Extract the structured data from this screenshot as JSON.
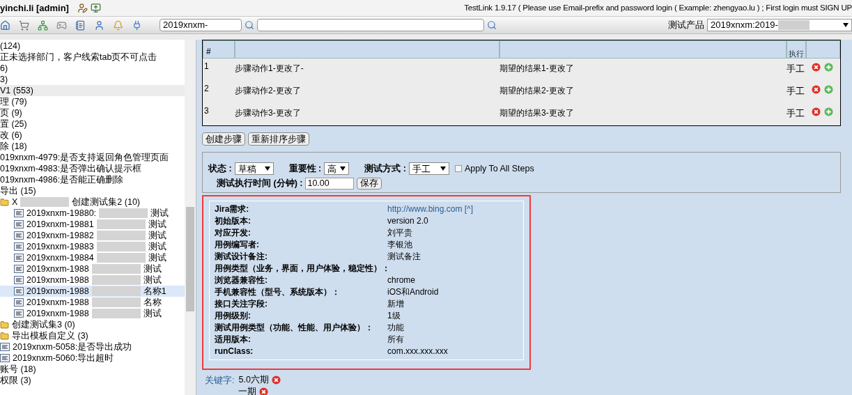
{
  "header": {
    "user": "yinchi.li [admin]",
    "title": "TestLink 1.9.17 ( Please use Email-prefix and password login ( Example: zhengyao.lu ) ; First login must SIGN UP"
  },
  "toolbar": {
    "search_value": "2019xnxm-",
    "product_label": "测试产品",
    "product_value": "2019xnxm:2019-"
  },
  "tree": [
    {
      "kind": "text",
      "label": "(124)",
      "selected": false
    },
    {
      "kind": "text",
      "label": "正未选择部门，客户线索tab页不可点击",
      "selected": false
    },
    {
      "kind": "text",
      "label": "6)",
      "selected": false
    },
    {
      "kind": "text",
      "label": "3)",
      "selected": false
    },
    {
      "kind": "text",
      "label": "V1 (553)",
      "selected": true
    },
    {
      "kind": "text",
      "label": "理 (79)",
      "selected": false
    },
    {
      "kind": "text",
      "label": "页 (9)",
      "selected": false
    },
    {
      "kind": "text",
      "label": "置 (25)",
      "selected": false
    },
    {
      "kind": "text",
      "label": "改 (6)",
      "selected": false
    },
    {
      "kind": "text",
      "label": "除 (18)",
      "selected": false
    },
    {
      "kind": "text",
      "label": "019xnxm-4979:是否支持返回角色管理页面",
      "selected": false
    },
    {
      "kind": "text",
      "label": "019xnxm-4983:是否弹出确认提示框",
      "selected": false
    },
    {
      "kind": "text",
      "label": "019xnxm-4986:是否能正确删除",
      "selected": false
    },
    {
      "kind": "text",
      "label": "导出 (15)",
      "selected": false
    },
    {
      "kind": "folder",
      "label": "X",
      "tail": "创建测试集2 (10)",
      "selected": false,
      "children": [
        {
          "kind": "case",
          "label": "2019xnxm-19880:",
          "tail": "测试",
          "selected": false
        },
        {
          "kind": "case",
          "label": "2019xnxm-19881",
          "tail": "测试",
          "selected": false
        },
        {
          "kind": "case",
          "label": "2019xnxm-19882",
          "tail": "测试",
          "selected": false
        },
        {
          "kind": "case",
          "label": "2019xnxm-19883",
          "tail": "测试",
          "selected": false
        },
        {
          "kind": "case",
          "label": "2019xnxm-19884",
          "tail": "测试",
          "selected": false
        },
        {
          "kind": "case",
          "label": "2019xnxm-1988",
          "tail": "测试",
          "selected": false
        },
        {
          "kind": "case",
          "label": "2019xnxm-1988",
          "tail": "测试",
          "selected": false
        },
        {
          "kind": "case",
          "label": "2019xnxm-1988",
          "tail": "名称1",
          "selected": true
        },
        {
          "kind": "case",
          "label": "2019xnxm-1988",
          "tail": "名称",
          "selected": false
        },
        {
          "kind": "case",
          "label": "2019xnxm-1988",
          "tail": "测试",
          "selected": false
        }
      ]
    },
    {
      "kind": "folder",
      "label": "创建测试集3 (0)",
      "selected": false
    },
    {
      "kind": "folder",
      "label": "导出模板自定义 (3)",
      "selected": false
    },
    {
      "kind": "case",
      "label": "2019xnxm-5058:是否导出成功",
      "selected": false
    },
    {
      "kind": "case",
      "label": "2019xnxm-5060:导出超时",
      "selected": false
    },
    {
      "kind": "text",
      "label": "账号 (18)",
      "selected": false
    },
    {
      "kind": "text",
      "label": "权限 (3)",
      "selected": false
    }
  ],
  "steps": {
    "columns": {
      "number": "#",
      "execution": "执行"
    },
    "rows": [
      {
        "number": "1",
        "action": "步骤动作1-更改了-",
        "expected": "期望的结果1-更改了",
        "execution": "手工"
      },
      {
        "number": "2",
        "action": "步骤动作2-更改了",
        "expected": "期望的结果2-更改了",
        "execution": "手工"
      },
      {
        "number": "3",
        "action": "步骤动作3-更改了",
        "expected": "期望的结果3-更改了",
        "execution": "手工"
      }
    ],
    "buttons": [
      "创建步骤",
      "重新排序步骤"
    ]
  },
  "attributes": {
    "status_label": "状态 :",
    "status": "草稿",
    "importance_label": "重要性 :",
    "importance": "高",
    "method_label": "测试方式 :",
    "method": "手工",
    "apply_all": {
      "label": "Apply To All Steps",
      "checked": false
    },
    "duration_label": "测试执行时间 (分钟) :",
    "duration": "10.00",
    "save": "保存"
  },
  "custom_fields": [
    {
      "label": "Jira需求:",
      "value": "http://www.bing.com [^]",
      "kind": "link"
    },
    {
      "label": "初始版本:",
      "value": "version 2.0",
      "kind": "text"
    },
    {
      "label": "对应开发:",
      "value": "刘平贵",
      "kind": "text"
    },
    {
      "label": "用例编写者:",
      "value": "李银池",
      "kind": "text"
    },
    {
      "label": "测试设计备注:",
      "value": "测试备注",
      "kind": "text"
    },
    {
      "label": "用例类型（业务，界面，用户体验，稳定性）："
    },
    {
      "label": "浏览器兼容性:",
      "value": "chrome",
      "kind": "text"
    },
    {
      "label": "手机兼容性（型号、系统版本）：",
      "value": "iOS和Android",
      "kind": "text"
    },
    {
      "label": "接口关注字段:",
      "value": "新增",
      "kind": "text"
    },
    {
      "label": "用例级别:",
      "value": "1级",
      "kind": "text"
    },
    {
      "label": "测试用例类型（功能、性能、用户体验）：",
      "value": "功能",
      "kind": "text"
    },
    {
      "label": "适用版本:",
      "value": "所有",
      "kind": "text"
    },
    {
      "label": "runClass:",
      "value": "com.xxx.xxx.xxx",
      "kind": "text"
    }
  ],
  "keywords": {
    "label": "关键字:",
    "items": [
      "5.0六期",
      "一期"
    ]
  }
}
